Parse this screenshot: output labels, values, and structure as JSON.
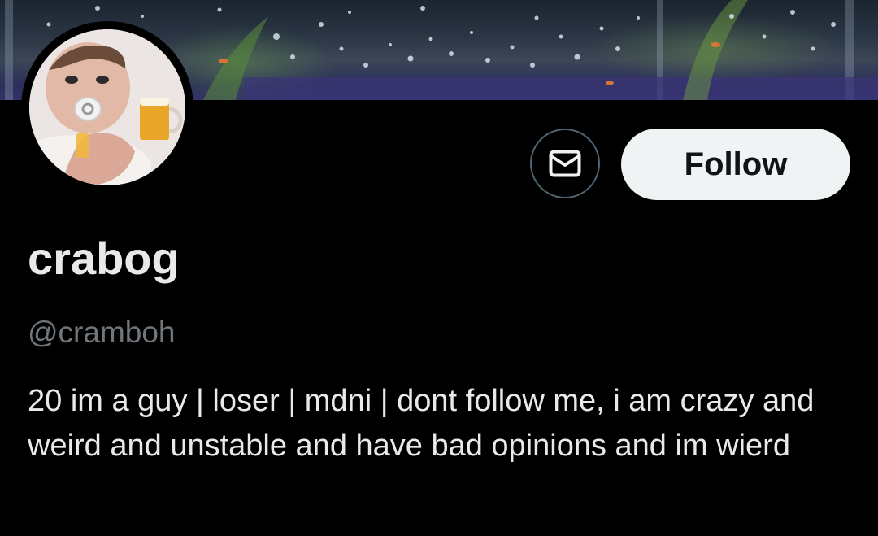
{
  "profile": {
    "display_name": "crabog",
    "handle": "@cramboh",
    "bio": "20 im a guy | loser | mdni | dont follow me, i am crazy and weird and unstable and have bad opinions and im wierd"
  },
  "actions": {
    "message_icon": "envelope-icon",
    "follow_label": "Follow"
  },
  "banner": {
    "subject": "aquarium-water-bubbles"
  },
  "colors": {
    "background": "#000000",
    "text_primary": "#e7e9ea",
    "text_secondary": "#71767b",
    "follow_button_bg": "#eff3f4",
    "follow_button_text": "#0f1419"
  }
}
